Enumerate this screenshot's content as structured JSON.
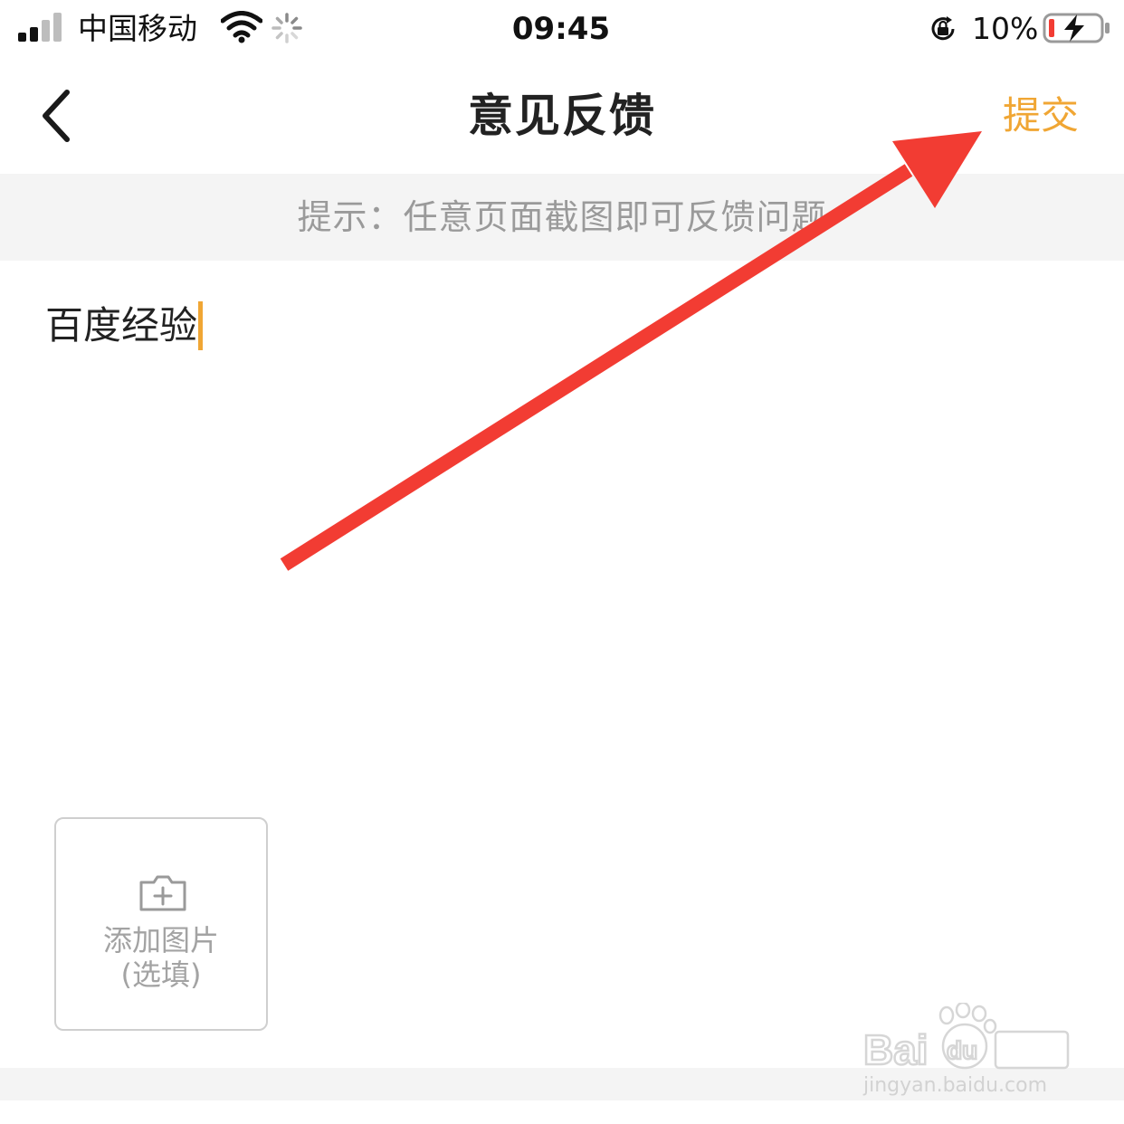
{
  "status_bar": {
    "carrier": "中国移动",
    "time": "09:45",
    "battery_percent": "10%",
    "icons": [
      "signal-icon",
      "wifi-icon",
      "loading-spinner-icon",
      "rotation-lock-icon",
      "battery-charging-icon"
    ]
  },
  "nav": {
    "title": "意见反馈",
    "submit_label": "提交",
    "back_icon": "chevron-left-icon"
  },
  "hint": {
    "text": "提示：任意页面截图即可反馈问题"
  },
  "feedback": {
    "value": "百度经验"
  },
  "add_image": {
    "label": "添加图片",
    "sublabel": "(选填)",
    "icon": "camera-plus-icon"
  },
  "watermark": {
    "url": "jingyan.baidu.com"
  },
  "colors": {
    "accent": "#f0a634",
    "annotation_arrow": "#f23c33",
    "hint_background": "#f4f4f4",
    "hint_text": "#9a9a9a"
  }
}
